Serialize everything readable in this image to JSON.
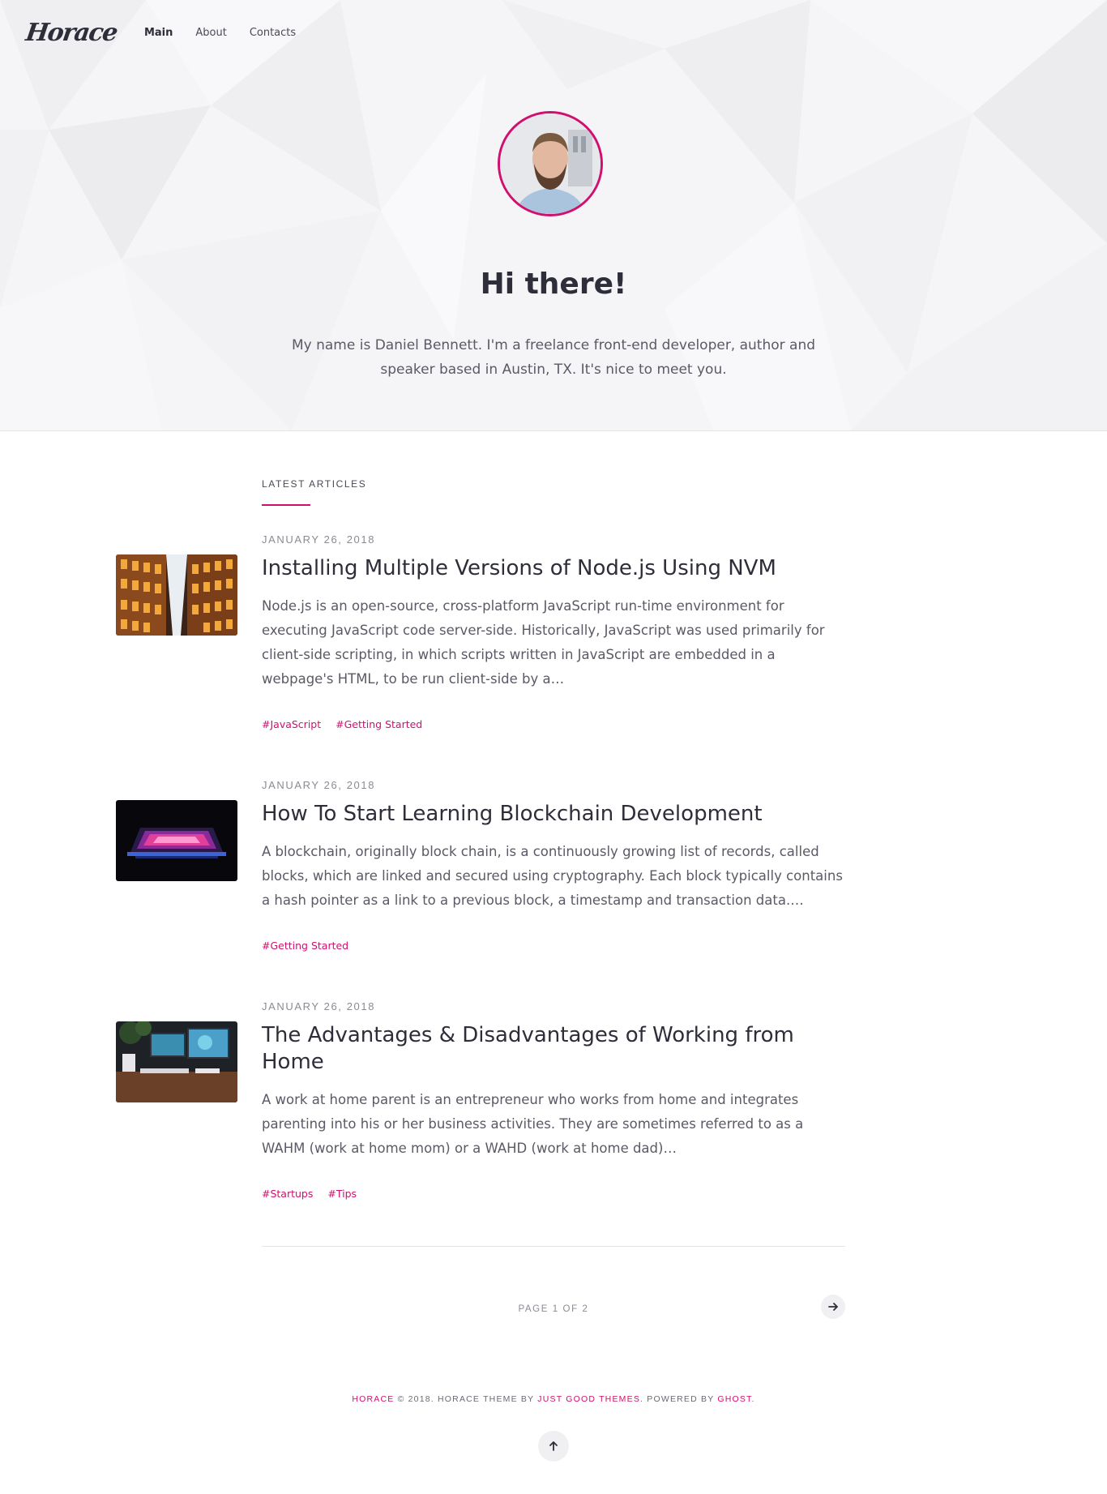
{
  "site": {
    "logo": "Horace",
    "nav": [
      {
        "label": "Main",
        "active": true
      },
      {
        "label": "About",
        "active": false
      },
      {
        "label": "Contacts",
        "active": false
      }
    ]
  },
  "hero": {
    "title": "Hi there!",
    "text": "My name is Daniel Bennett. I'm a freelance front-end developer, author and speaker based in Austin, TX. It's nice to meet you."
  },
  "section": {
    "label": "LATEST ARTICLES"
  },
  "articles": [
    {
      "date": "JANUARY 26, 2018",
      "title": "Installing Multiple Versions of Node.js Using NVM",
      "excerpt": "Node.js is an open-source, cross-platform JavaScript run-time environment for executing JavaScript code server-side. Historically, JavaScript was used primarily for client-side scripting, in which scripts written in JavaScript are embedded in a webpage's HTML, to be run client-side by a…",
      "tags": [
        "#JavaScript",
        "#Getting Started"
      ],
      "thumb_icon": "building-facade-image"
    },
    {
      "date": "JANUARY 26, 2018",
      "title": "How To Start Learning Blockchain Development",
      "excerpt": "A blockchain, originally block chain, is a continuously growing list of records, called blocks, which are linked and secured using cryptography. Each block typically contains a hash pointer as a link to a previous block, a timestamp and transaction data.…",
      "tags": [
        "#Getting Started"
      ],
      "thumb_icon": "neon-laptop-image"
    },
    {
      "date": "JANUARY 26, 2018",
      "title": "The Advantages & Disadvantages of Working from Home",
      "excerpt": "A work at home parent is an entrepreneur who works from home and integrates parenting into his or her business activities. They are sometimes referred to as a WAHM (work at home mom) or a WAHD (work at home dad)…",
      "tags": [
        "#Startups",
        "#Tips"
      ],
      "thumb_icon": "desk-monitors-image"
    }
  ],
  "pagination": {
    "text": "PAGE 1 OF 2",
    "next_icon": "arrow-right-icon"
  },
  "footer": {
    "brand": "HORACE",
    "copy": " © 2018. HORACE THEME BY ",
    "theme_link": "JUST GOOD THEMES",
    "powered": ". POWERED BY ",
    "ghost_link": "GHOST",
    "end": ".",
    "top_icon": "arrow-up-icon"
  },
  "colors": {
    "accent": "#d0106f",
    "text": "#2e2e3a",
    "muted": "#5a5a66",
    "hero_bg": "#f5f5f7"
  }
}
